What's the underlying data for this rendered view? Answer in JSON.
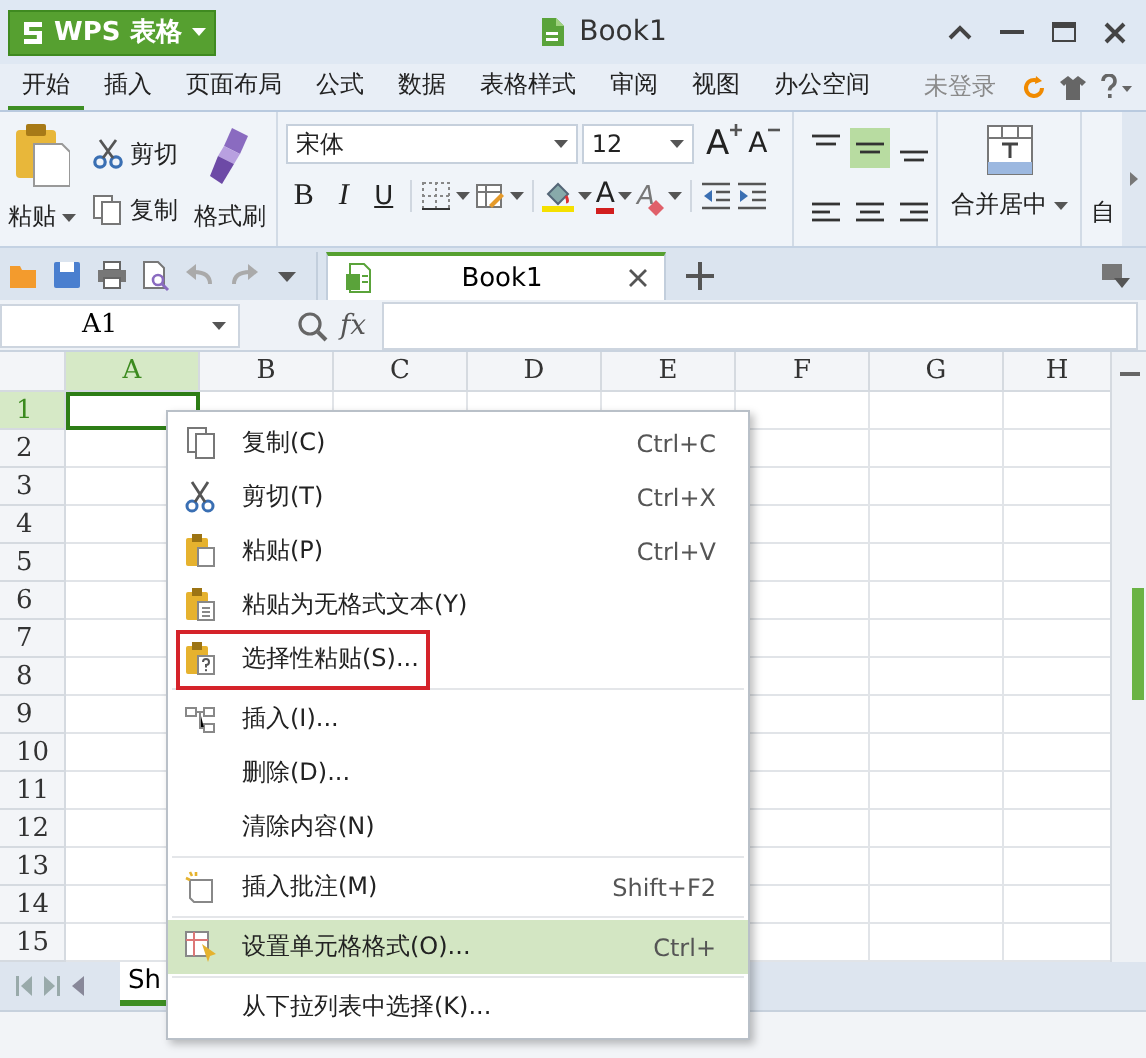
{
  "app_menu": {
    "label": "WPS 表格"
  },
  "window": {
    "title": "Book1"
  },
  "menu_tabs": [
    {
      "label": "开始",
      "selected": true
    },
    {
      "label": "插入",
      "selected": false
    },
    {
      "label": "页面布局",
      "selected": false
    },
    {
      "label": "公式",
      "selected": false
    },
    {
      "label": "数据",
      "selected": false
    },
    {
      "label": "表格样式",
      "selected": false
    },
    {
      "label": "审阅",
      "selected": false
    },
    {
      "label": "视图",
      "selected": false
    },
    {
      "label": "办公空间",
      "selected": false
    }
  ],
  "account": {
    "label": "未登录"
  },
  "ribbon": {
    "clipboard": {
      "paste": "粘贴",
      "cut": "剪切",
      "copy": "复制",
      "format_painter": "格式刷"
    },
    "font": {
      "name": "宋体",
      "size": "12",
      "grow": "A",
      "shrink": "A",
      "bold": "B",
      "italic": "I",
      "underline": "U",
      "font_color": "A",
      "clear": "A"
    },
    "alignment": [
      {
        "kind": "top",
        "selected": false
      },
      {
        "kind": "middle",
        "selected": true
      },
      {
        "kind": "bottom",
        "selected": false
      },
      {
        "kind": "left",
        "selected": false
      },
      {
        "kind": "center",
        "selected": false
      },
      {
        "kind": "right",
        "selected": false
      }
    ],
    "merge": {
      "label": "合并居中"
    },
    "next_group": {
      "label": "自"
    }
  },
  "doc_tabs": [
    {
      "label": "Book1",
      "selected": true
    }
  ],
  "formula_bar": {
    "name_box": "A1",
    "function_label": "fx"
  },
  "grid": {
    "columns": [
      {
        "label": "A",
        "selected": true
      },
      {
        "label": "B",
        "selected": false
      },
      {
        "label": "C",
        "selected": false
      },
      {
        "label": "D",
        "selected": false
      },
      {
        "label": "E",
        "selected": false
      },
      {
        "label": "F",
        "selected": false
      },
      {
        "label": "G",
        "selected": false
      },
      {
        "label": "H",
        "selected": false
      }
    ],
    "rows": [
      {
        "label": "1",
        "selected": true
      },
      {
        "label": "2",
        "selected": false
      },
      {
        "label": "3",
        "selected": false
      },
      {
        "label": "4",
        "selected": false
      },
      {
        "label": "5",
        "selected": false
      },
      {
        "label": "6",
        "selected": false
      },
      {
        "label": "7",
        "selected": false
      },
      {
        "label": "8",
        "selected": false
      },
      {
        "label": "9",
        "selected": false
      },
      {
        "label": "10",
        "selected": false
      },
      {
        "label": "11",
        "selected": false
      },
      {
        "label": "12",
        "selected": false
      },
      {
        "label": "13",
        "selected": false
      },
      {
        "label": "14",
        "selected": false
      },
      {
        "label": "15",
        "selected": false
      }
    ]
  },
  "sheet_tabs": [
    {
      "label": "Sh",
      "selected": true
    }
  ],
  "context_menu": {
    "groups": [
      [
        {
          "label": "复制(C)",
          "shortcut": "Ctrl+C",
          "kind": "copy",
          "selected": false,
          "outlined": false
        },
        {
          "label": "剪切(T)",
          "shortcut": "Ctrl+X",
          "kind": "cut",
          "selected": false,
          "outlined": false
        },
        {
          "label": "粘贴(P)",
          "shortcut": "Ctrl+V",
          "kind": "paste",
          "selected": false,
          "outlined": false
        },
        {
          "label": "粘贴为无格式文本(Y)",
          "kind": "paste-text",
          "selected": false,
          "outlined": false
        },
        {
          "label": "选择性粘贴(S)...",
          "kind": "paste-special",
          "selected": false,
          "outlined": true
        }
      ],
      [
        {
          "label": "插入(I)...",
          "kind": "insert",
          "selected": false,
          "outlined": false
        },
        {
          "label": "删除(D)...",
          "selected": false,
          "outlined": false
        },
        {
          "label": "清除内容(N)",
          "selected": false,
          "outlined": false
        }
      ],
      [
        {
          "label": "插入批注(M)",
          "shortcut": "Shift+F2",
          "kind": "comment",
          "selected": false,
          "outlined": false
        }
      ],
      [
        {
          "label": "设置单元格格式(O)...",
          "shortcut": "Ctrl+",
          "kind": "format-cells",
          "selected": true,
          "outlined": false
        }
      ],
      [
        {
          "label": "从下拉列表中选择(K)...",
          "selected": false,
          "outlined": false
        }
      ]
    ]
  }
}
